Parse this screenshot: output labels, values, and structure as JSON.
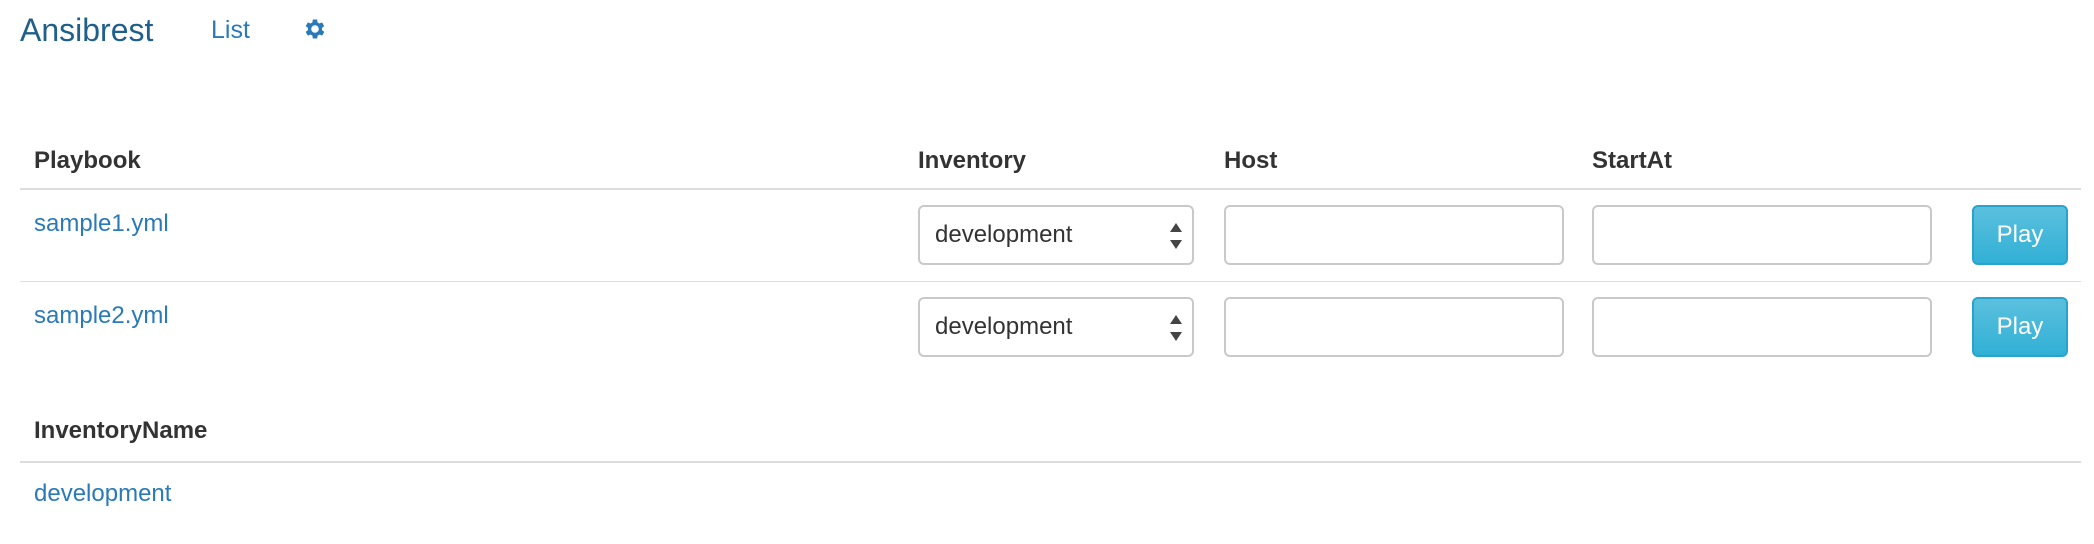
{
  "navbar": {
    "brand": "Ansibrest",
    "list_label": "List",
    "settings_icon": "gear-icon",
    "accent_color": "#2a7ab8"
  },
  "playbooks_table": {
    "headers": {
      "playbook": "Playbook",
      "inventory": "Inventory",
      "host": "Host",
      "start_at": "StartAt"
    },
    "rows": [
      {
        "playbook": "sample1.yml",
        "inventory_selected": "development",
        "host_value": "",
        "start_at_value": "",
        "play_label": "Play"
      },
      {
        "playbook": "sample2.yml",
        "inventory_selected": "development",
        "host_value": "",
        "start_at_value": "",
        "play_label": "Play"
      }
    ]
  },
  "inventories_table": {
    "header": "InventoryName",
    "rows": [
      {
        "name": "development"
      }
    ]
  }
}
